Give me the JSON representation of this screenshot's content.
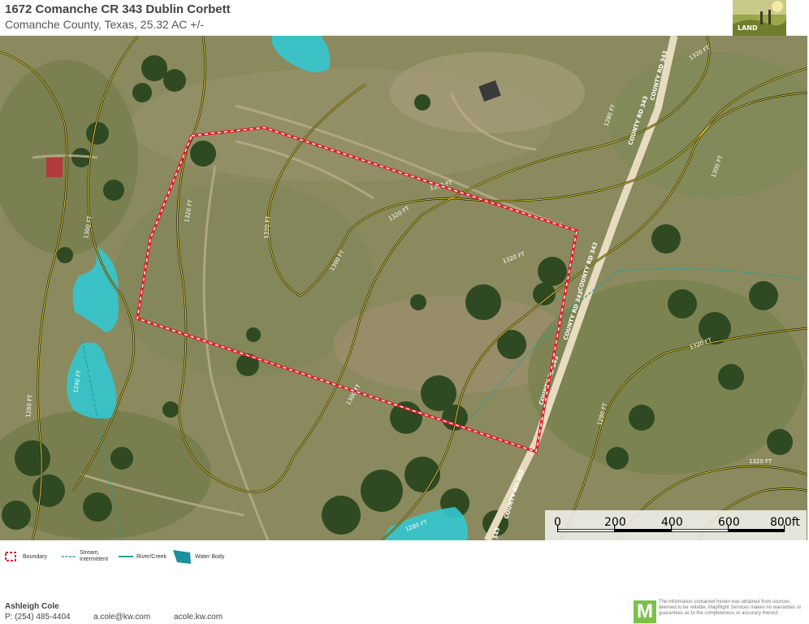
{
  "header": {
    "title": "1672 Comanche CR 343 Dublin Corbett",
    "subtitle": "Comanche County, Texas, 25.32 AC +/-",
    "logo_icon": "land-photo-logo-icon",
    "logo_text": "LAND"
  },
  "map": {
    "contour_labels": [
      "1320 FT",
      "1300 FT",
      "1280 FT",
      "1240 FT",
      "1260 FT"
    ],
    "road_labels": [
      "COUNTY RD 343",
      "COUNTY RD 343",
      "COUNTY RD 343",
      "COUNTY RD 343",
      "COUNTY RD 343",
      "COUNTY RD 343",
      "343"
    ],
    "colors": {
      "boundary": "#e0202a",
      "water": "#33c7cf",
      "contour": "#d9c52a",
      "road": "#e8dcc0"
    },
    "scale": {
      "ticks": [
        "0",
        "200",
        "400",
        "600",
        "800ft"
      ]
    }
  },
  "legend": {
    "boundary": "Boundary",
    "stream_line1": "Stream,",
    "stream_line2": "Intermittent",
    "river": "River/Creek",
    "water_body": "Water Body"
  },
  "footer": {
    "name": "Ashleigh Cole",
    "phone": "P: (254) 485-4404",
    "email": "a.cole@kw.com",
    "website": "acole.kw.com",
    "logo_letter": "M",
    "disclaimer": "The information contained herein was obtained from sources deemed to be reliable. MapRight Services makes no warranties or guarantees as to the completeness or accuracy thereof."
  }
}
